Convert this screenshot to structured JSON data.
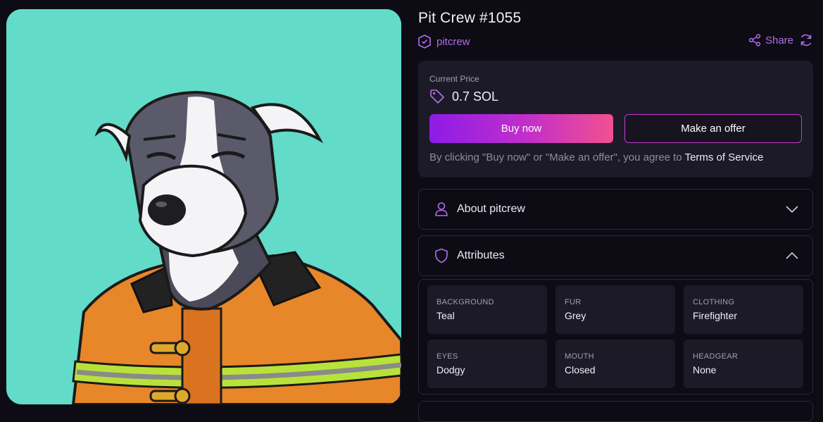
{
  "nft": {
    "title": "Pit Crew #1055",
    "collection": "pitcrew",
    "image_icon": "dog-firefighter-artwork"
  },
  "actions": {
    "share_label": "Share",
    "share_icon": "share-icon",
    "refresh_icon": "refresh-icon"
  },
  "pricing": {
    "label": "Current Price",
    "value": "0.7 SOL",
    "buy_label": "Buy now",
    "offer_label": "Make an offer",
    "terms_prefix": "By clicking \"Buy now\" or \"Make an offer\", you agree to ",
    "terms_link": "Terms of Service"
  },
  "panels": {
    "about_label": "About pitcrew",
    "attributes_label": "Attributes"
  },
  "attributes": [
    {
      "key": "BACKGROUND",
      "value": "Teal"
    },
    {
      "key": "FUR",
      "value": "Grey"
    },
    {
      "key": "CLOTHING",
      "value": "Firefighter"
    },
    {
      "key": "EYES",
      "value": "Dodgy"
    },
    {
      "key": "MOUTH",
      "value": "Closed"
    },
    {
      "key": "HEADGEAR",
      "value": "None"
    }
  ],
  "colors": {
    "accent": "#b46cf0",
    "background": "#0d0b14",
    "card": "#1d1a28",
    "art_background": "#62dbc8"
  }
}
